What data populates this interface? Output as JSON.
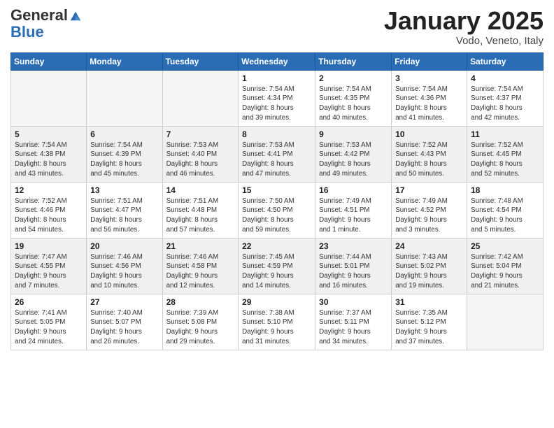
{
  "header": {
    "logo_line1": "General",
    "logo_line2": "Blue",
    "month": "January 2025",
    "location": "Vodo, Veneto, Italy"
  },
  "weekdays": [
    "Sunday",
    "Monday",
    "Tuesday",
    "Wednesday",
    "Thursday",
    "Friday",
    "Saturday"
  ],
  "weeks": [
    [
      {
        "day": "",
        "info": ""
      },
      {
        "day": "",
        "info": ""
      },
      {
        "day": "",
        "info": ""
      },
      {
        "day": "1",
        "info": "Sunrise: 7:54 AM\nSunset: 4:34 PM\nDaylight: 8 hours\nand 39 minutes."
      },
      {
        "day": "2",
        "info": "Sunrise: 7:54 AM\nSunset: 4:35 PM\nDaylight: 8 hours\nand 40 minutes."
      },
      {
        "day": "3",
        "info": "Sunrise: 7:54 AM\nSunset: 4:36 PM\nDaylight: 8 hours\nand 41 minutes."
      },
      {
        "day": "4",
        "info": "Sunrise: 7:54 AM\nSunset: 4:37 PM\nDaylight: 8 hours\nand 42 minutes."
      }
    ],
    [
      {
        "day": "5",
        "info": "Sunrise: 7:54 AM\nSunset: 4:38 PM\nDaylight: 8 hours\nand 43 minutes."
      },
      {
        "day": "6",
        "info": "Sunrise: 7:54 AM\nSunset: 4:39 PM\nDaylight: 8 hours\nand 45 minutes."
      },
      {
        "day": "7",
        "info": "Sunrise: 7:53 AM\nSunset: 4:40 PM\nDaylight: 8 hours\nand 46 minutes."
      },
      {
        "day": "8",
        "info": "Sunrise: 7:53 AM\nSunset: 4:41 PM\nDaylight: 8 hours\nand 47 minutes."
      },
      {
        "day": "9",
        "info": "Sunrise: 7:53 AM\nSunset: 4:42 PM\nDaylight: 8 hours\nand 49 minutes."
      },
      {
        "day": "10",
        "info": "Sunrise: 7:52 AM\nSunset: 4:43 PM\nDaylight: 8 hours\nand 50 minutes."
      },
      {
        "day": "11",
        "info": "Sunrise: 7:52 AM\nSunset: 4:45 PM\nDaylight: 8 hours\nand 52 minutes."
      }
    ],
    [
      {
        "day": "12",
        "info": "Sunrise: 7:52 AM\nSunset: 4:46 PM\nDaylight: 8 hours\nand 54 minutes."
      },
      {
        "day": "13",
        "info": "Sunrise: 7:51 AM\nSunset: 4:47 PM\nDaylight: 8 hours\nand 56 minutes."
      },
      {
        "day": "14",
        "info": "Sunrise: 7:51 AM\nSunset: 4:48 PM\nDaylight: 8 hours\nand 57 minutes."
      },
      {
        "day": "15",
        "info": "Sunrise: 7:50 AM\nSunset: 4:50 PM\nDaylight: 8 hours\nand 59 minutes."
      },
      {
        "day": "16",
        "info": "Sunrise: 7:49 AM\nSunset: 4:51 PM\nDaylight: 9 hours\nand 1 minute."
      },
      {
        "day": "17",
        "info": "Sunrise: 7:49 AM\nSunset: 4:52 PM\nDaylight: 9 hours\nand 3 minutes."
      },
      {
        "day": "18",
        "info": "Sunrise: 7:48 AM\nSunset: 4:54 PM\nDaylight: 9 hours\nand 5 minutes."
      }
    ],
    [
      {
        "day": "19",
        "info": "Sunrise: 7:47 AM\nSunset: 4:55 PM\nDaylight: 9 hours\nand 7 minutes."
      },
      {
        "day": "20",
        "info": "Sunrise: 7:46 AM\nSunset: 4:56 PM\nDaylight: 9 hours\nand 10 minutes."
      },
      {
        "day": "21",
        "info": "Sunrise: 7:46 AM\nSunset: 4:58 PM\nDaylight: 9 hours\nand 12 minutes."
      },
      {
        "day": "22",
        "info": "Sunrise: 7:45 AM\nSunset: 4:59 PM\nDaylight: 9 hours\nand 14 minutes."
      },
      {
        "day": "23",
        "info": "Sunrise: 7:44 AM\nSunset: 5:01 PM\nDaylight: 9 hours\nand 16 minutes."
      },
      {
        "day": "24",
        "info": "Sunrise: 7:43 AM\nSunset: 5:02 PM\nDaylight: 9 hours\nand 19 minutes."
      },
      {
        "day": "25",
        "info": "Sunrise: 7:42 AM\nSunset: 5:04 PM\nDaylight: 9 hours\nand 21 minutes."
      }
    ],
    [
      {
        "day": "26",
        "info": "Sunrise: 7:41 AM\nSunset: 5:05 PM\nDaylight: 9 hours\nand 24 minutes."
      },
      {
        "day": "27",
        "info": "Sunrise: 7:40 AM\nSunset: 5:07 PM\nDaylight: 9 hours\nand 26 minutes."
      },
      {
        "day": "28",
        "info": "Sunrise: 7:39 AM\nSunset: 5:08 PM\nDaylight: 9 hours\nand 29 minutes."
      },
      {
        "day": "29",
        "info": "Sunrise: 7:38 AM\nSunset: 5:10 PM\nDaylight: 9 hours\nand 31 minutes."
      },
      {
        "day": "30",
        "info": "Sunrise: 7:37 AM\nSunset: 5:11 PM\nDaylight: 9 hours\nand 34 minutes."
      },
      {
        "day": "31",
        "info": "Sunrise: 7:35 AM\nSunset: 5:12 PM\nDaylight: 9 hours\nand 37 minutes."
      },
      {
        "day": "",
        "info": ""
      }
    ]
  ]
}
